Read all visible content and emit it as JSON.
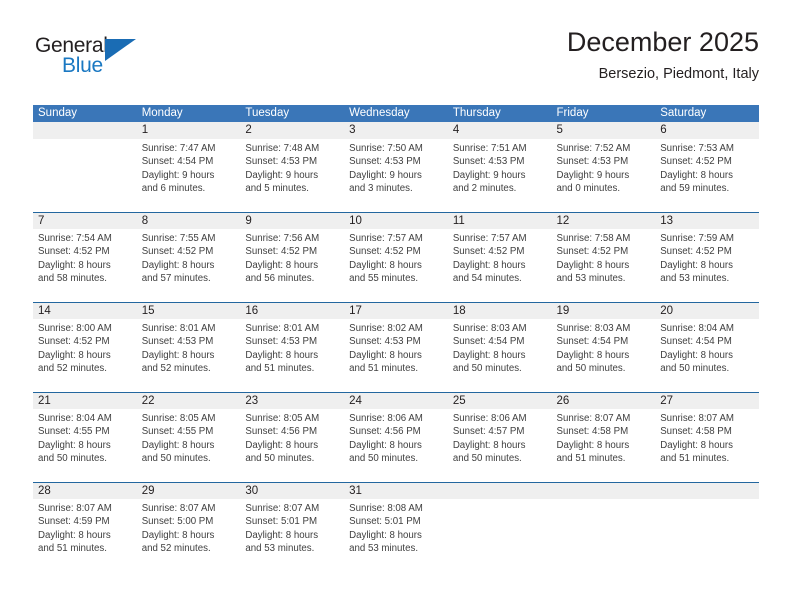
{
  "brand": {
    "name_part1": "General",
    "name_part2": "Blue",
    "triangle_icon": "triangle-logo-icon",
    "accent_color": "#1a78c2"
  },
  "header": {
    "title": "December 2025",
    "subtitle": "Bersezio, Piedmont, Italy"
  },
  "colors": {
    "header_blue": "#3a76b8",
    "separator_blue": "#23679f",
    "daynum_band": "#efefef",
    "text": "#231f20",
    "detail_text": "#404040"
  },
  "weekdays": [
    "Sunday",
    "Monday",
    "Tuesday",
    "Wednesday",
    "Thursday",
    "Friday",
    "Saturday"
  ],
  "weeks": [
    {
      "days": [
        {
          "num": "",
          "lines": [
            "",
            "",
            "",
            ""
          ]
        },
        {
          "num": "1",
          "lines": [
            "Sunrise: 7:47 AM",
            "Sunset: 4:54 PM",
            "Daylight: 9 hours",
            "and 6 minutes."
          ]
        },
        {
          "num": "2",
          "lines": [
            "Sunrise: 7:48 AM",
            "Sunset: 4:53 PM",
            "Daylight: 9 hours",
            "and 5 minutes."
          ]
        },
        {
          "num": "3",
          "lines": [
            "Sunrise: 7:50 AM",
            "Sunset: 4:53 PM",
            "Daylight: 9 hours",
            "and 3 minutes."
          ]
        },
        {
          "num": "4",
          "lines": [
            "Sunrise: 7:51 AM",
            "Sunset: 4:53 PM",
            "Daylight: 9 hours",
            "and 2 minutes."
          ]
        },
        {
          "num": "5",
          "lines": [
            "Sunrise: 7:52 AM",
            "Sunset: 4:53 PM",
            "Daylight: 9 hours",
            "and 0 minutes."
          ]
        },
        {
          "num": "6",
          "lines": [
            "Sunrise: 7:53 AM",
            "Sunset: 4:52 PM",
            "Daylight: 8 hours",
            "and 59 minutes."
          ]
        }
      ]
    },
    {
      "days": [
        {
          "num": "7",
          "lines": [
            "Sunrise: 7:54 AM",
            "Sunset: 4:52 PM",
            "Daylight: 8 hours",
            "and 58 minutes."
          ]
        },
        {
          "num": "8",
          "lines": [
            "Sunrise: 7:55 AM",
            "Sunset: 4:52 PM",
            "Daylight: 8 hours",
            "and 57 minutes."
          ]
        },
        {
          "num": "9",
          "lines": [
            "Sunrise: 7:56 AM",
            "Sunset: 4:52 PM",
            "Daylight: 8 hours",
            "and 56 minutes."
          ]
        },
        {
          "num": "10",
          "lines": [
            "Sunrise: 7:57 AM",
            "Sunset: 4:52 PM",
            "Daylight: 8 hours",
            "and 55 minutes."
          ]
        },
        {
          "num": "11",
          "lines": [
            "Sunrise: 7:57 AM",
            "Sunset: 4:52 PM",
            "Daylight: 8 hours",
            "and 54 minutes."
          ]
        },
        {
          "num": "12",
          "lines": [
            "Sunrise: 7:58 AM",
            "Sunset: 4:52 PM",
            "Daylight: 8 hours",
            "and 53 minutes."
          ]
        },
        {
          "num": "13",
          "lines": [
            "Sunrise: 7:59 AM",
            "Sunset: 4:52 PM",
            "Daylight: 8 hours",
            "and 53 minutes."
          ]
        }
      ]
    },
    {
      "days": [
        {
          "num": "14",
          "lines": [
            "Sunrise: 8:00 AM",
            "Sunset: 4:52 PM",
            "Daylight: 8 hours",
            "and 52 minutes."
          ]
        },
        {
          "num": "15",
          "lines": [
            "Sunrise: 8:01 AM",
            "Sunset: 4:53 PM",
            "Daylight: 8 hours",
            "and 52 minutes."
          ]
        },
        {
          "num": "16",
          "lines": [
            "Sunrise: 8:01 AM",
            "Sunset: 4:53 PM",
            "Daylight: 8 hours",
            "and 51 minutes."
          ]
        },
        {
          "num": "17",
          "lines": [
            "Sunrise: 8:02 AM",
            "Sunset: 4:53 PM",
            "Daylight: 8 hours",
            "and 51 minutes."
          ]
        },
        {
          "num": "18",
          "lines": [
            "Sunrise: 8:03 AM",
            "Sunset: 4:54 PM",
            "Daylight: 8 hours",
            "and 50 minutes."
          ]
        },
        {
          "num": "19",
          "lines": [
            "Sunrise: 8:03 AM",
            "Sunset: 4:54 PM",
            "Daylight: 8 hours",
            "and 50 minutes."
          ]
        },
        {
          "num": "20",
          "lines": [
            "Sunrise: 8:04 AM",
            "Sunset: 4:54 PM",
            "Daylight: 8 hours",
            "and 50 minutes."
          ]
        }
      ]
    },
    {
      "days": [
        {
          "num": "21",
          "lines": [
            "Sunrise: 8:04 AM",
            "Sunset: 4:55 PM",
            "Daylight: 8 hours",
            "and 50 minutes."
          ]
        },
        {
          "num": "22",
          "lines": [
            "Sunrise: 8:05 AM",
            "Sunset: 4:55 PM",
            "Daylight: 8 hours",
            "and 50 minutes."
          ]
        },
        {
          "num": "23",
          "lines": [
            "Sunrise: 8:05 AM",
            "Sunset: 4:56 PM",
            "Daylight: 8 hours",
            "and 50 minutes."
          ]
        },
        {
          "num": "24",
          "lines": [
            "Sunrise: 8:06 AM",
            "Sunset: 4:56 PM",
            "Daylight: 8 hours",
            "and 50 minutes."
          ]
        },
        {
          "num": "25",
          "lines": [
            "Sunrise: 8:06 AM",
            "Sunset: 4:57 PM",
            "Daylight: 8 hours",
            "and 50 minutes."
          ]
        },
        {
          "num": "26",
          "lines": [
            "Sunrise: 8:07 AM",
            "Sunset: 4:58 PM",
            "Daylight: 8 hours",
            "and 51 minutes."
          ]
        },
        {
          "num": "27",
          "lines": [
            "Sunrise: 8:07 AM",
            "Sunset: 4:58 PM",
            "Daylight: 8 hours",
            "and 51 minutes."
          ]
        }
      ]
    },
    {
      "days": [
        {
          "num": "28",
          "lines": [
            "Sunrise: 8:07 AM",
            "Sunset: 4:59 PM",
            "Daylight: 8 hours",
            "and 51 minutes."
          ]
        },
        {
          "num": "29",
          "lines": [
            "Sunrise: 8:07 AM",
            "Sunset: 5:00 PM",
            "Daylight: 8 hours",
            "and 52 minutes."
          ]
        },
        {
          "num": "30",
          "lines": [
            "Sunrise: 8:07 AM",
            "Sunset: 5:01 PM",
            "Daylight: 8 hours",
            "and 53 minutes."
          ]
        },
        {
          "num": "31",
          "lines": [
            "Sunrise: 8:08 AM",
            "Sunset: 5:01 PM",
            "Daylight: 8 hours",
            "and 53 minutes."
          ]
        },
        {
          "num": "",
          "lines": [
            "",
            "",
            "",
            ""
          ]
        },
        {
          "num": "",
          "lines": [
            "",
            "",
            "",
            ""
          ]
        },
        {
          "num": "",
          "lines": [
            "",
            "",
            "",
            ""
          ]
        }
      ]
    }
  ]
}
